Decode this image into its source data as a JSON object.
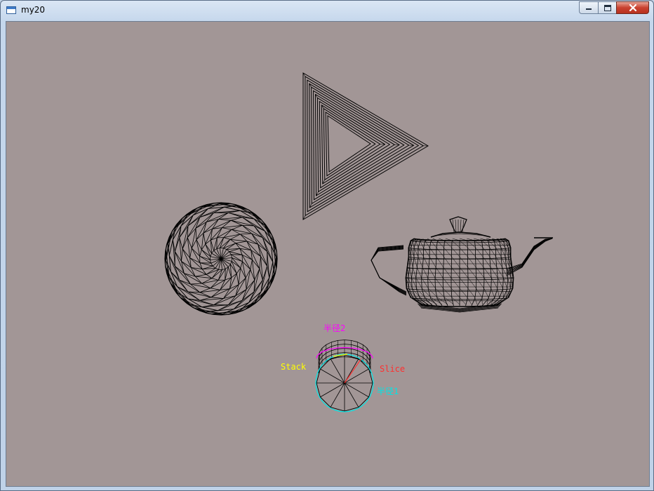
{
  "window": {
    "title": "my20",
    "icon": "window-app-icon",
    "controls": [
      "minimize-icon",
      "maximize-icon",
      "close-icon"
    ]
  },
  "scene": {
    "background": "#a29696",
    "wire_color": "#000000",
    "objects": [
      "torus",
      "sphere",
      "teapot",
      "cylinder"
    ]
  },
  "labels": {
    "radius2": "半径2",
    "stack": "Stack",
    "slice": "Slice",
    "radius1": "半径1"
  },
  "colors": {
    "radius2": "#ff00ff",
    "stack": "#ffff00",
    "slice": "#ff3030",
    "radius1": "#00e5e5"
  }
}
